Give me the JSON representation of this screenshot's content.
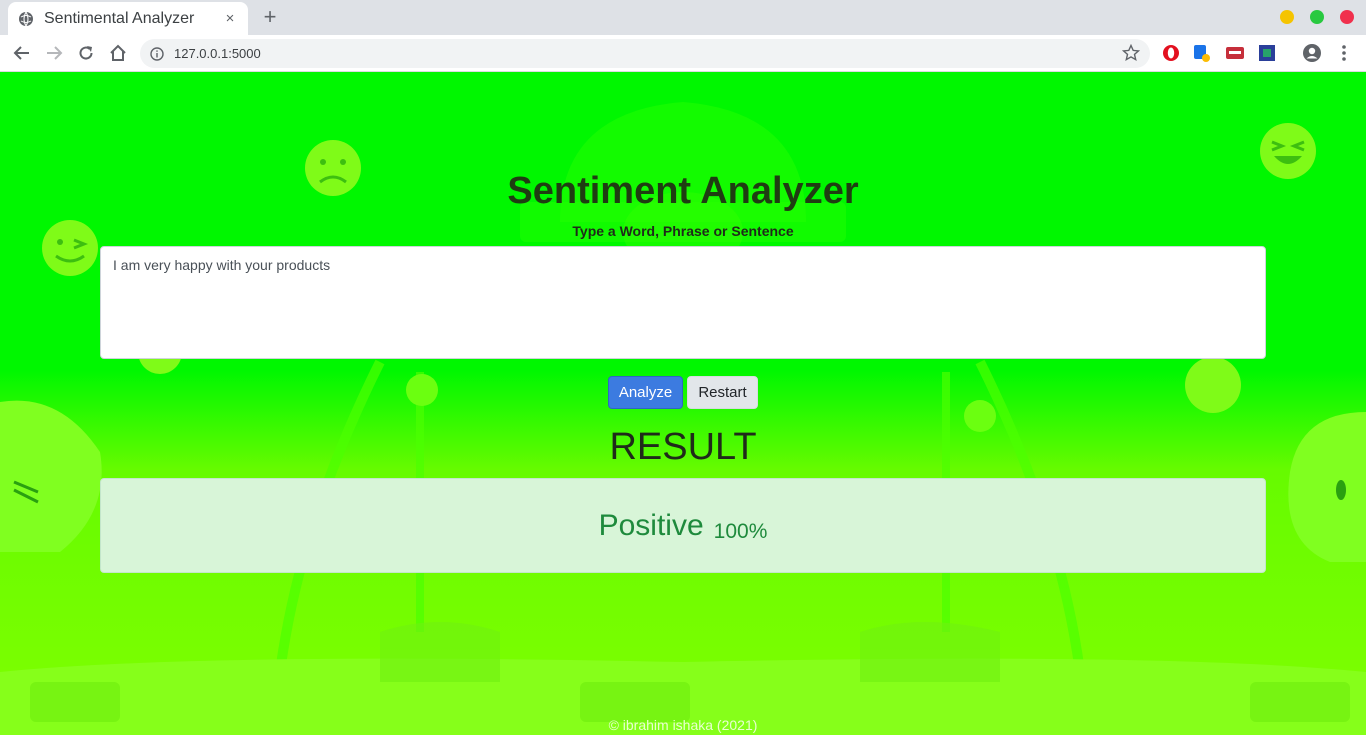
{
  "browser": {
    "tab_title": "Sentimental Analyzer",
    "tab_close": "×",
    "new_tab": "+",
    "url": "127.0.0.1:5000",
    "window_buttons": [
      {
        "name": "minimize",
        "color": "#f5c400"
      },
      {
        "name": "maximize",
        "color": "#28c940"
      },
      {
        "name": "close",
        "color": "#f0304d"
      }
    ],
    "extensions": [
      "opera-extension-icon",
      "translate-extension-icon",
      "reader-extension-icon",
      "screenshot-extension-icon"
    ]
  },
  "page": {
    "title": "Sentiment Analyzer",
    "subtitle": "Type a Word, Phrase or Sentence",
    "input_value": "I am very happy with your products",
    "analyze_label": "Analyze",
    "restart_label": "Restart",
    "result_heading": "RESULT",
    "result_label": "Positive",
    "result_percent": "100%",
    "footer": "© ibrahim ishaka (2021)"
  },
  "colors": {
    "background": "#00f700",
    "accent_button": "#3c7be0",
    "result_bg": "#d8f5d8",
    "result_text": "#1e8a3c"
  }
}
